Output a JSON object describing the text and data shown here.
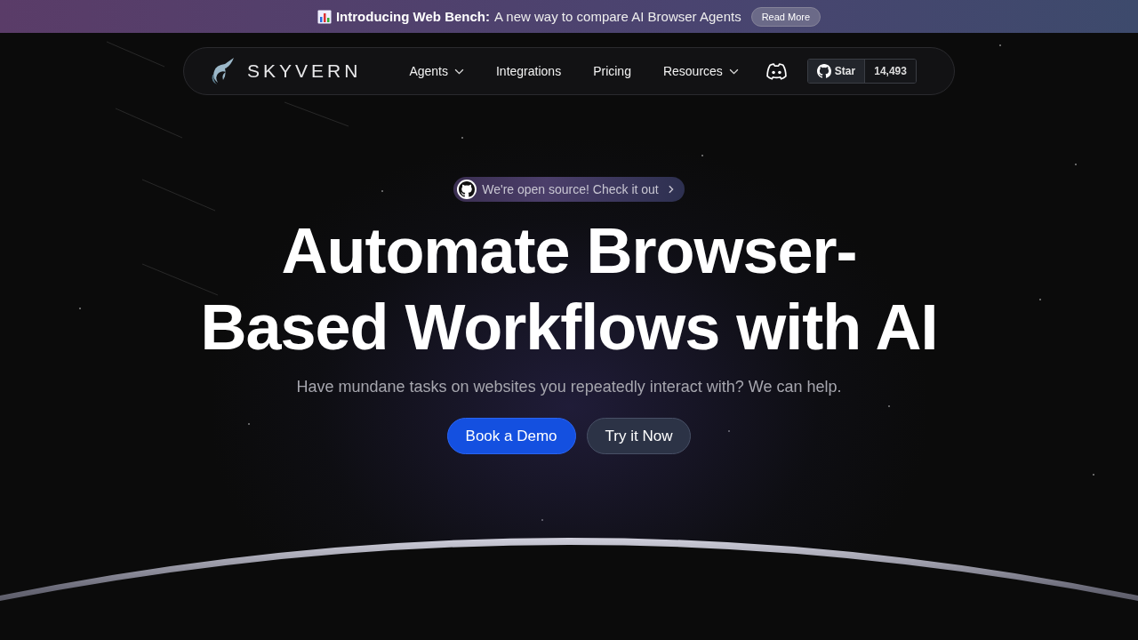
{
  "announcement": {
    "title": "Introducing Web Bench:",
    "text": "A new way to compare AI Browser Agents",
    "button": "Read More"
  },
  "nav": {
    "logo": "SKYVERN",
    "items": [
      {
        "label": "Agents",
        "dropdown": true
      },
      {
        "label": "Integrations",
        "dropdown": false
      },
      {
        "label": "Pricing",
        "dropdown": false
      },
      {
        "label": "Resources",
        "dropdown": true
      }
    ],
    "github": {
      "label": "Star",
      "count": "14,493"
    }
  },
  "hero": {
    "pill": "We're open source! Check it out",
    "title_lines": [
      "Automate Browser-",
      "Based Workflows with AI"
    ],
    "subtitle": "Have mundane tasks on websites you repeatedly interact with? We can help.",
    "buttons": [
      {
        "label": "Book a Demo",
        "kind": "primary"
      },
      {
        "label": "Try it Now",
        "kind": "secondary"
      }
    ]
  }
}
